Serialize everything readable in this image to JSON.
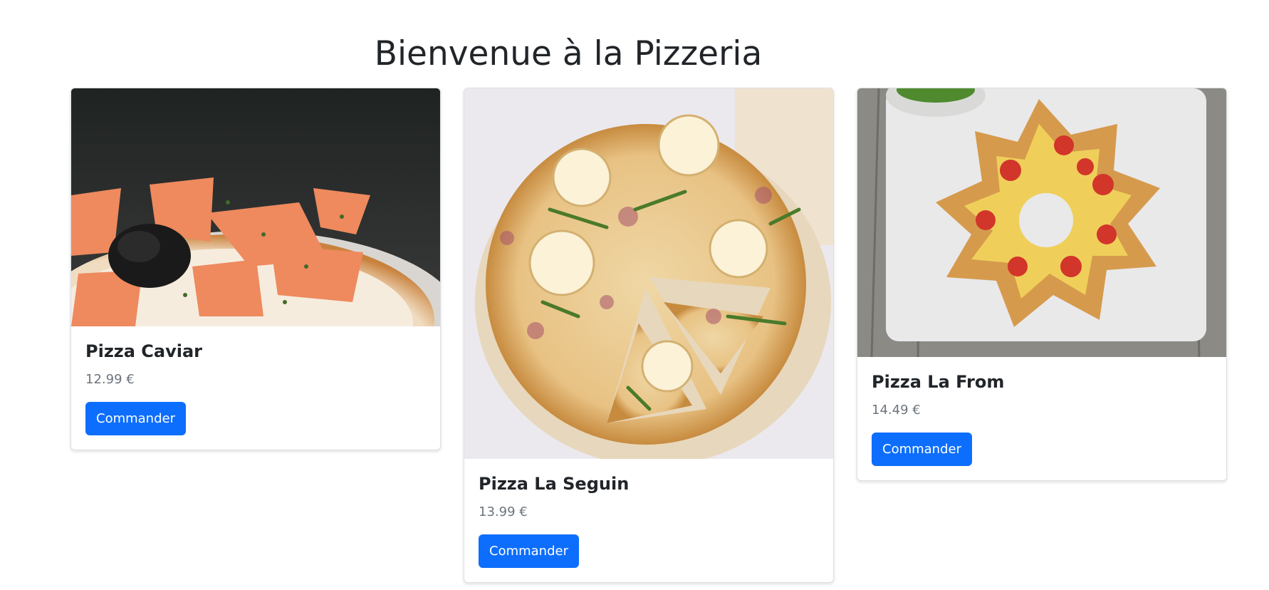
{
  "page": {
    "title": "Bienvenue à la Pizzeria"
  },
  "pizzas": [
    {
      "name": "Pizza Caviar",
      "price": "12.99 €",
      "button_label": "Commander",
      "image_icon": "pizza-caviar-photo"
    },
    {
      "name": "Pizza La Seguin",
      "price": "13.99 €",
      "button_label": "Commander",
      "image_icon": "pizza-la-seguin-photo"
    },
    {
      "name": "Pizza La From",
      "price": "14.49 €",
      "button_label": "Commander",
      "image_icon": "pizza-la-from-photo"
    }
  ],
  "colors": {
    "primary": "#0d6efd",
    "price_text": "#6c757d",
    "heading_text": "#212529"
  }
}
